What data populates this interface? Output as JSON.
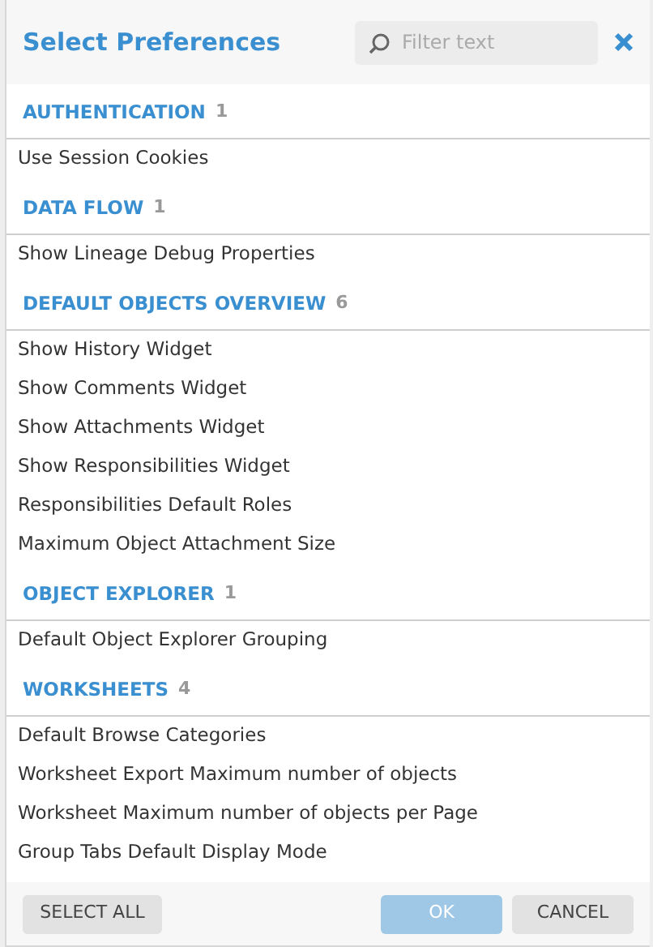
{
  "dialog": {
    "title": "Select Preferences",
    "filter": {
      "placeholder": "Filter text"
    }
  },
  "sections": [
    {
      "title": "AUTHENTICATION",
      "count": "1",
      "items": [
        "Use Session Cookies"
      ]
    },
    {
      "title": "DATA FLOW",
      "count": "1",
      "items": [
        "Show Lineage Debug Properties"
      ]
    },
    {
      "title": "DEFAULT OBJECTS OVERVIEW",
      "count": "6",
      "items": [
        "Show History Widget",
        "Show Comments Widget",
        "Show Attachments Widget",
        "Show Responsibilities Widget",
        "Responsibilities Default Roles",
        "Maximum Object Attachment Size"
      ]
    },
    {
      "title": "OBJECT EXPLORER",
      "count": "1",
      "items": [
        "Default Object Explorer Grouping"
      ]
    },
    {
      "title": "WORKSHEETS",
      "count": "4",
      "items": [
        "Default Browse Categories",
        "Worksheet Export Maximum number of objects",
        "Worksheet Maximum number of objects per Page",
        "Group Tabs Default Display Mode"
      ]
    }
  ],
  "footer": {
    "select_all": "SELECT ALL",
    "ok": {
      "label": "OK",
      "disabled": true
    },
    "cancel": "CANCEL"
  }
}
